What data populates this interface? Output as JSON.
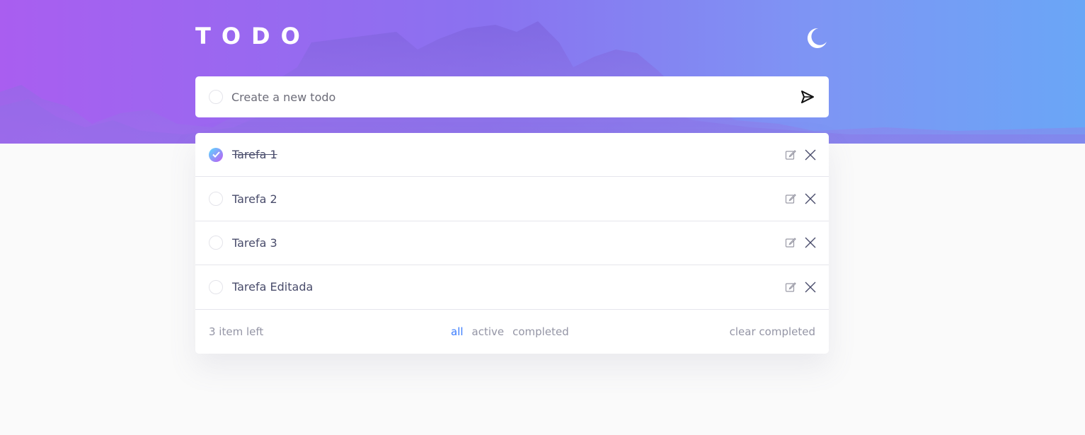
{
  "app": {
    "title": "TODO"
  },
  "colors": {
    "accent": "#3a7cfd",
    "check_gradient_start": "#57ddff",
    "check_gradient_end": "#c058f3",
    "hero_start": "#a95ef0",
    "hero_end": "#6aa6f6"
  },
  "theme_toggle": {
    "icon": "moon-icon"
  },
  "new_todo": {
    "placeholder": "Create a new todo",
    "value": "",
    "send_icon": "send-icon"
  },
  "todos": [
    {
      "text": "Tarefa 1",
      "completed": true
    },
    {
      "text": "Tarefa 2",
      "completed": false
    },
    {
      "text": "Tarefa 3",
      "completed": false
    },
    {
      "text": "Tarefa Editada",
      "completed": false
    }
  ],
  "row_icons": {
    "edit": "edit-icon",
    "delete": "close-icon"
  },
  "footer": {
    "items_left": "3 item left",
    "filters": {
      "all": "all",
      "active": "active",
      "completed": "completed"
    },
    "active_filter": "all",
    "clear": "clear completed"
  }
}
